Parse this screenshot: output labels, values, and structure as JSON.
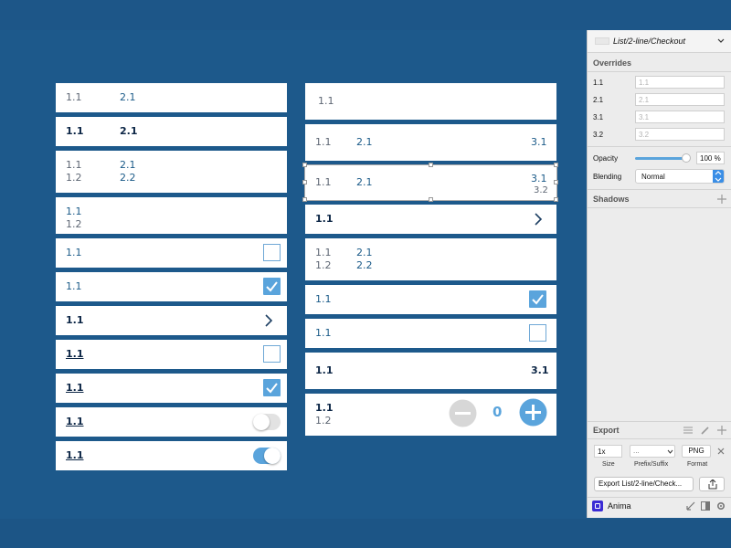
{
  "left_list": {
    "r1": {
      "a": "1.1",
      "b": "2.1"
    },
    "r2": {
      "a": "1.1",
      "b": "2.1"
    },
    "r3": {
      "a": "1.1",
      "b": "2.1",
      "c": "1.2",
      "d": "2.2"
    },
    "r4": {
      "a": "1.1",
      "c": "1.2"
    },
    "r5": {
      "a": "1.1"
    },
    "r6": {
      "a": "1.1"
    },
    "r7": {
      "a": "1.1"
    },
    "r8": {
      "a": "1.1"
    },
    "r9": {
      "a": "1.1"
    },
    "r10": {
      "a": "1.1"
    },
    "r11": {
      "a": "1.1"
    }
  },
  "right_list": {
    "r1": {
      "a": "1.1"
    },
    "r2": {
      "a": "1.1",
      "b": "2.1",
      "c": "3.1"
    },
    "r3": {
      "a": "1.1",
      "b": "2.1",
      "c": "3.1",
      "d": "3.2"
    },
    "r4": {
      "a": "1.1"
    },
    "r5": {
      "a": "1.1",
      "b": "2.1",
      "c": "1.2",
      "d": "2.2"
    },
    "r6": {
      "a": "1.1"
    },
    "r7": {
      "a": "1.1"
    },
    "r8": {
      "a": "1.1",
      "c": "3.1"
    },
    "r9": {
      "a": "1.1",
      "b": "1.2",
      "qty": "0"
    }
  },
  "panel": {
    "symbol_name": "List/2-line/Checkout",
    "overrides_title": "Overrides",
    "overrides": [
      {
        "label": "1.1",
        "placeholder": "1.1"
      },
      {
        "label": "2.1",
        "placeholder": "2.1"
      },
      {
        "label": "3.1",
        "placeholder": "3.1"
      },
      {
        "label": "3.2",
        "placeholder": "3.2"
      }
    ],
    "opacity_label": "Opacity",
    "opacity_value": "100 %",
    "opacity_level": 1.0,
    "blending_label": "Blending",
    "blending_value": "Normal",
    "shadows_title": "Shadows",
    "export_title": "Export",
    "export_size": "1x",
    "export_prefix": "...",
    "export_format": "PNG",
    "size_caption": "Size",
    "prefix_caption": "Prefix/Suffix",
    "format_caption": "Format",
    "export_button": "Export List/2-line/Check...",
    "plugin_name": "Anima"
  },
  "colors": {
    "background": "#1d598b",
    "accent": "#5aa4dc",
    "text_dark": "#0b2545",
    "panel_bg": "#ececec"
  },
  "icons": [
    "chevron-right-icon",
    "checkmark-icon",
    "minus-icon",
    "plus-icon",
    "share-icon",
    "gear-icon",
    "pencil-icon",
    "settings-icon"
  ]
}
